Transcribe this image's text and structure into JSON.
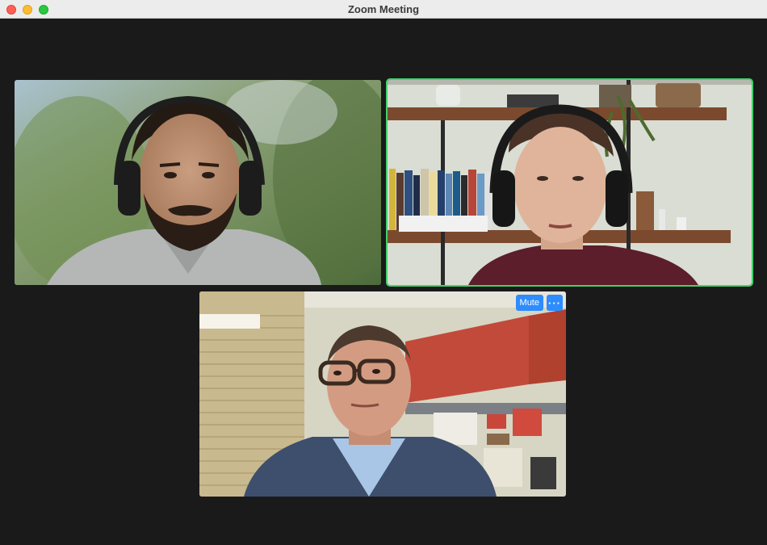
{
  "window": {
    "title": "Zoom Meeting"
  },
  "participants": [
    {
      "id": "participant-1",
      "active_speaker": false
    },
    {
      "id": "participant-2",
      "active_speaker": true
    },
    {
      "id": "participant-3",
      "active_speaker": false
    }
  ],
  "tile_controls": {
    "mute_label": "Mute",
    "more_label": "···"
  },
  "colors": {
    "meeting_background": "#1a1a1a",
    "active_speaker_border": "#3fd26b",
    "control_button": "#2d8cff"
  }
}
